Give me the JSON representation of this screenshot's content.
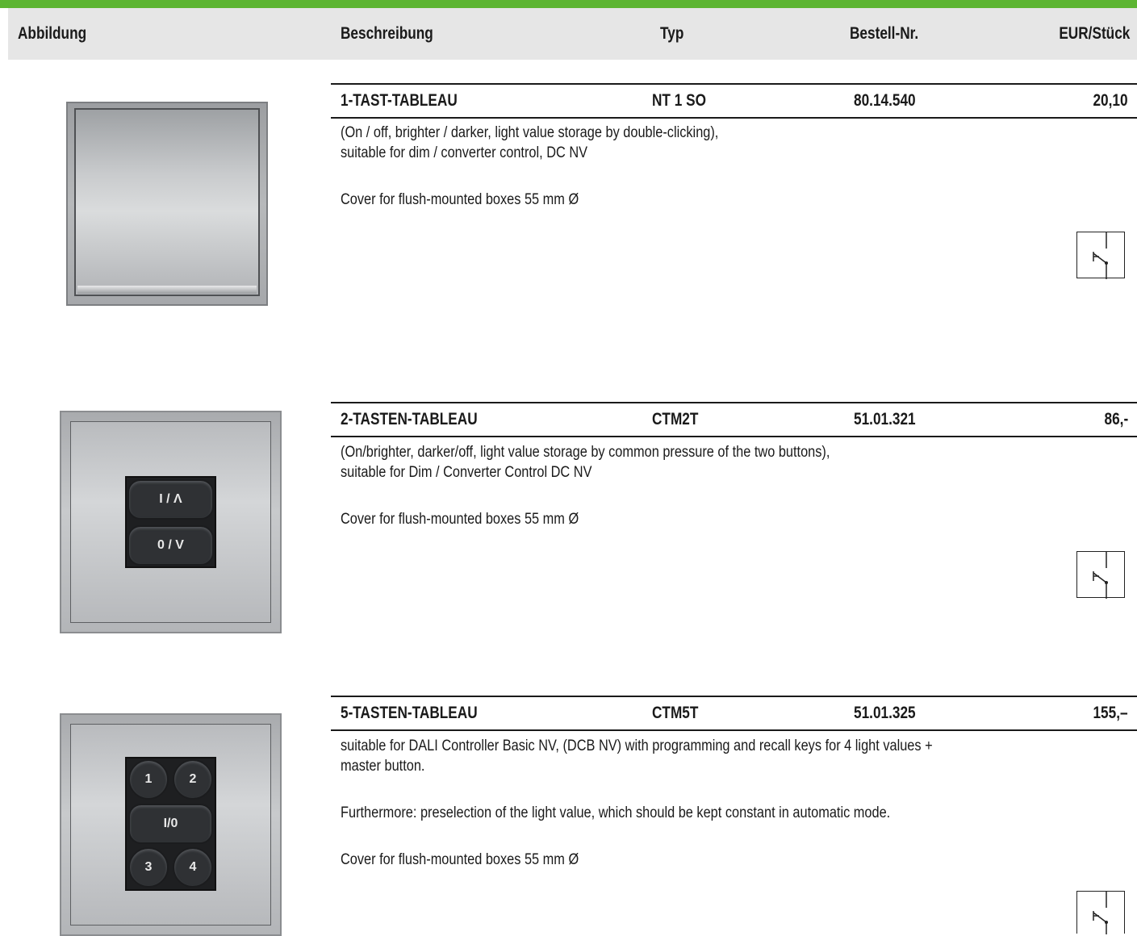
{
  "header": {
    "col_picture": "Abbildung",
    "col_description": "Beschreibung",
    "col_type": "Typ",
    "col_order_no": "Bestell-Nr.",
    "col_price": "EUR/Stück"
  },
  "products": [
    {
      "name": "1-TAST-TABLEAU",
      "type": "NT 1 SO",
      "order_no": "80.14.540",
      "price": "20,10",
      "desc_lines": [
        "(On / off, brighter / darker, light value storage by double-clicking),",
        "suitable for dim / converter control, DC NV",
        "",
        "Cover for flush-mounted boxes 55 mm Ø"
      ]
    },
    {
      "name": "2-TASTEN-TABLEAU",
      "type": "CTM2T",
      "order_no": "51.01.321",
      "price": "86,-",
      "key_labels": [
        "I / Λ",
        "0 / V"
      ],
      "desc_lines": [
        "(On/brighter, darker/off, light value storage by common pressure of the two buttons),",
        "suitable for Dim / Converter Control DC NV",
        "",
        "Cover for flush-mounted boxes 55 mm Ø"
      ]
    },
    {
      "name": "5-TASTEN-TABLEAU",
      "type": "CTM5T",
      "order_no": "51.01.325",
      "price": "155,–",
      "key_labels": [
        "1",
        "2",
        "I/0",
        "3",
        "4"
      ],
      "desc_lines": [
        "suitable for DALI Controller Basic NV, (DCB NV) with programming and recall keys for 4 light values +",
        "master button.",
        "",
        "Furthermore: preselection of the light value, which should be kept constant in automatic mode.",
        "",
        "Cover for flush-mounted boxes 55 mm Ø"
      ]
    }
  ],
  "colors": {
    "accent_bar": "#5cb532",
    "header_bg": "#e6e6e6"
  }
}
